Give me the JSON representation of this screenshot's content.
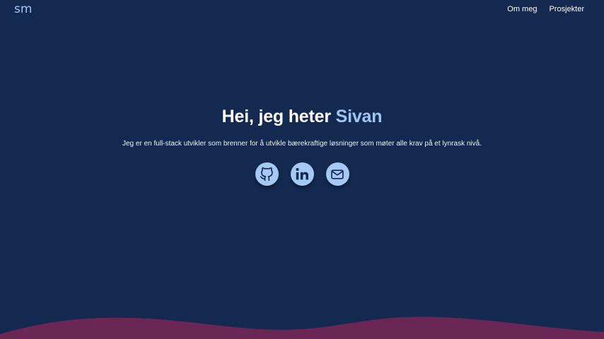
{
  "header": {
    "logo_text": "sm",
    "nav": [
      {
        "label": "Om meg"
      },
      {
        "label": "Prosjekter"
      }
    ]
  },
  "hero": {
    "title_prefix": "Hei, jeg heter ",
    "title_name": "Sivan",
    "description": "Jeg er en full-stack utvikler som brenner for å utvikle bærekraftige løsninger som møter alle krav på et lynrask nivå."
  },
  "socials": [
    {
      "icon": "github-icon"
    },
    {
      "icon": "linkedin-icon"
    },
    {
      "icon": "mail-icon"
    }
  ],
  "colors": {
    "background": "#13294f",
    "accent": "#9ec5f6",
    "icon_circle": "#a6c8f4",
    "wave": "#6a2654"
  }
}
